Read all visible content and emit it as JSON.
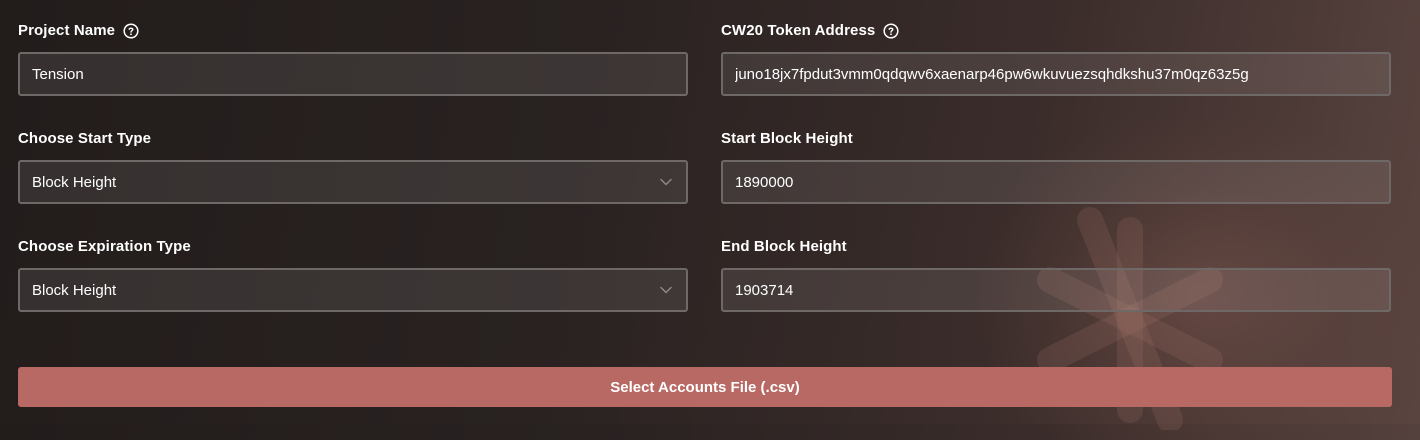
{
  "form": {
    "project_name": {
      "label": "Project Name",
      "value": "Tension",
      "help_icon": "question-circle-icon"
    },
    "token_address": {
      "label": "CW20 Token Address",
      "value": "juno18jx7fpdut3vmm0qdqwv6xaenarp46pw6wkuvuezsqhdkshu37m0qz63z5g",
      "help_icon": "question-circle-icon"
    },
    "start_type": {
      "label": "Choose Start Type",
      "selected": "Block Height",
      "icon": "chevron-down-icon"
    },
    "start_block_height": {
      "label": "Start Block Height",
      "value": "1890000"
    },
    "expiration_type": {
      "label": "Choose Expiration Type",
      "selected": "Block Height",
      "icon": "chevron-down-icon"
    },
    "end_block_height": {
      "label": "End Block Height",
      "value": "1903714"
    },
    "submit_label": "Select Accounts File (.csv)"
  },
  "colors": {
    "accent": "#b86964",
    "input_border": "#6e6866",
    "background": "#221c1b"
  }
}
